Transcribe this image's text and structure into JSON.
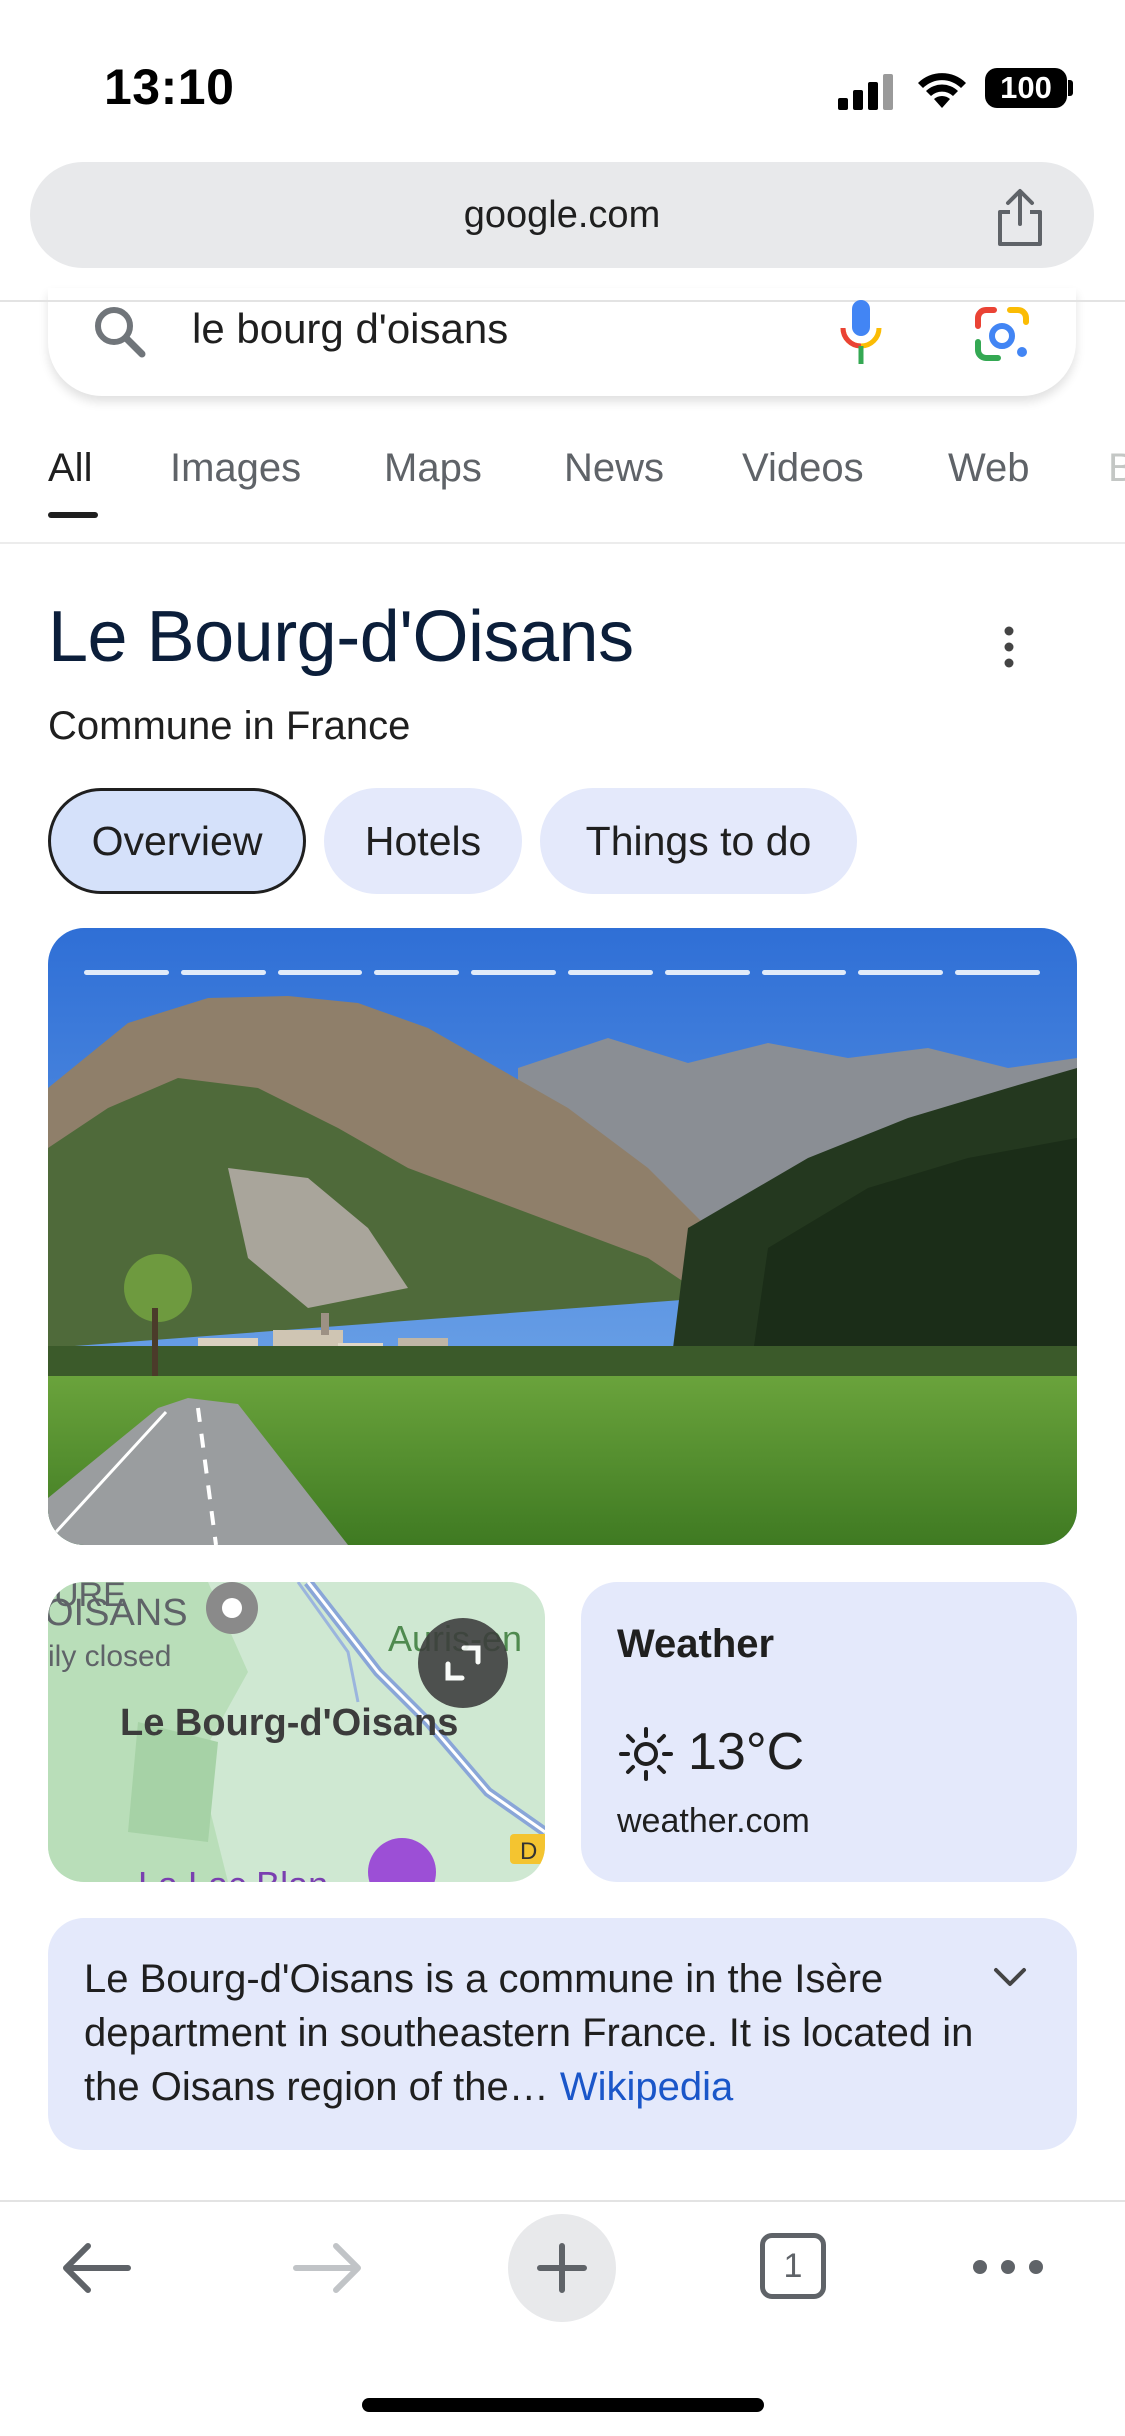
{
  "status_bar": {
    "time": "13:10",
    "battery": "100"
  },
  "browser": {
    "url": "google.com"
  },
  "search": {
    "query": "le bourg d'oisans"
  },
  "tabs": [
    "All",
    "Images",
    "Maps",
    "News",
    "Videos",
    "Web",
    "B"
  ],
  "knowledge_panel": {
    "title": "Le Bourg-d'Oisans",
    "subtitle": "Commune in France",
    "chips": [
      "Overview",
      "Hotels",
      "Things to do"
    ],
    "map": {
      "label": "Le Bourg-d'Oisans",
      "partial_labels": [
        "OISANS",
        "ily closed",
        "Auris-en",
        "D",
        "La Lac Blan"
      ],
      "partial_top": "URE"
    },
    "weather": {
      "title": "Weather",
      "temperature": "13°C",
      "source": "weather.com"
    },
    "description": {
      "text": "Le Bourg-d'Oisans is a commune in the Isère department in southeastern France. It is located in the Oisans region of the…",
      "link": "Wikipedia"
    }
  },
  "toolbar": {
    "tab_count": "1"
  }
}
